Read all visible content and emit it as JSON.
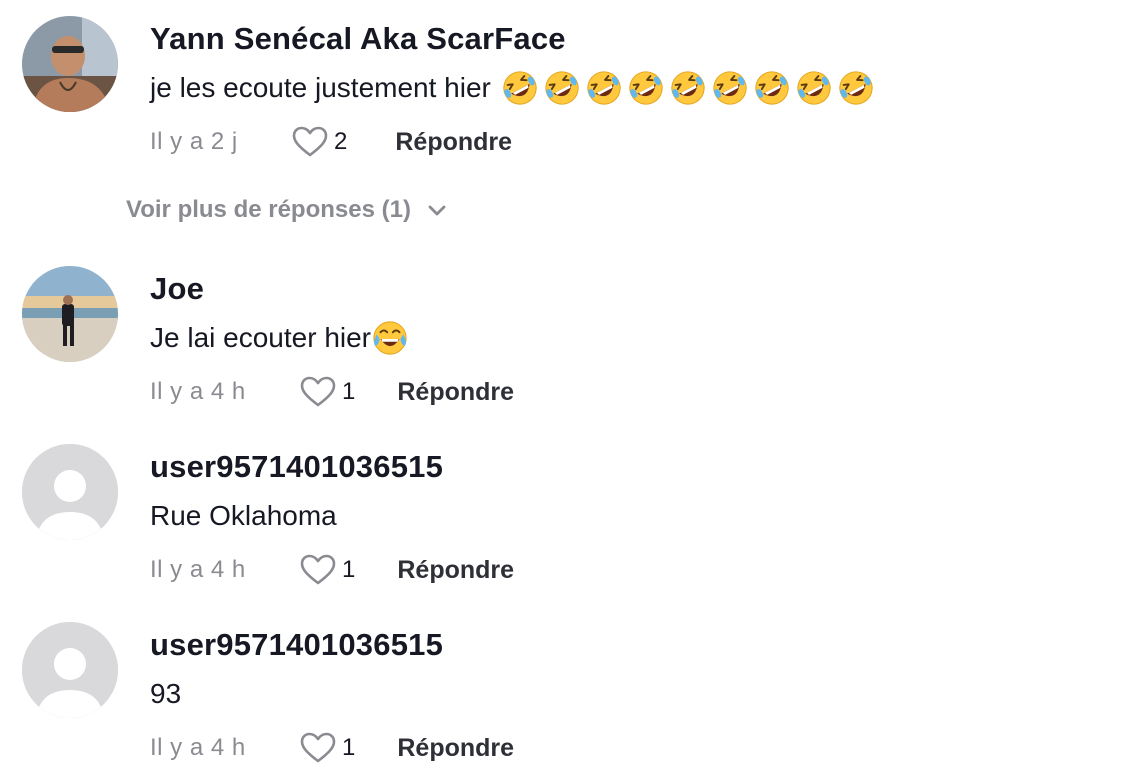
{
  "comments": [
    {
      "username": "Yann Senécal Aka ScarFace",
      "text": "je les ecoute justement hier",
      "emoji": "rolling-on-floor-laughing-icon",
      "emoji_count": 9,
      "time": "Il y a 2 j",
      "likes": "2",
      "reply_label": "Répondre"
    },
    {
      "username": "Joe",
      "text": "Je lai ecouter hier",
      "emoji": "face-with-tears-of-joy-icon",
      "emoji_count": 1,
      "time": "Il y a 4 h",
      "likes": "1",
      "reply_label": "Répondre"
    },
    {
      "username": "user9571401036515",
      "text": "Rue Oklahoma",
      "time": "Il y a 4 h",
      "likes": "1",
      "reply_label": "Répondre"
    },
    {
      "username": "user9571401036515",
      "text": "93",
      "time": "Il y a 4 h",
      "likes": "1",
      "reply_label": "Répondre"
    }
  ],
  "more_replies": {
    "label": "Voir plus de réponses (1)",
    "icon": "chevron-down-icon"
  },
  "colors": {
    "primary_text": "#161823",
    "secondary_text": "#8a8b91",
    "default_avatar_bg": "#d9d9dc",
    "emoji_yellow": "#ffc83d"
  }
}
